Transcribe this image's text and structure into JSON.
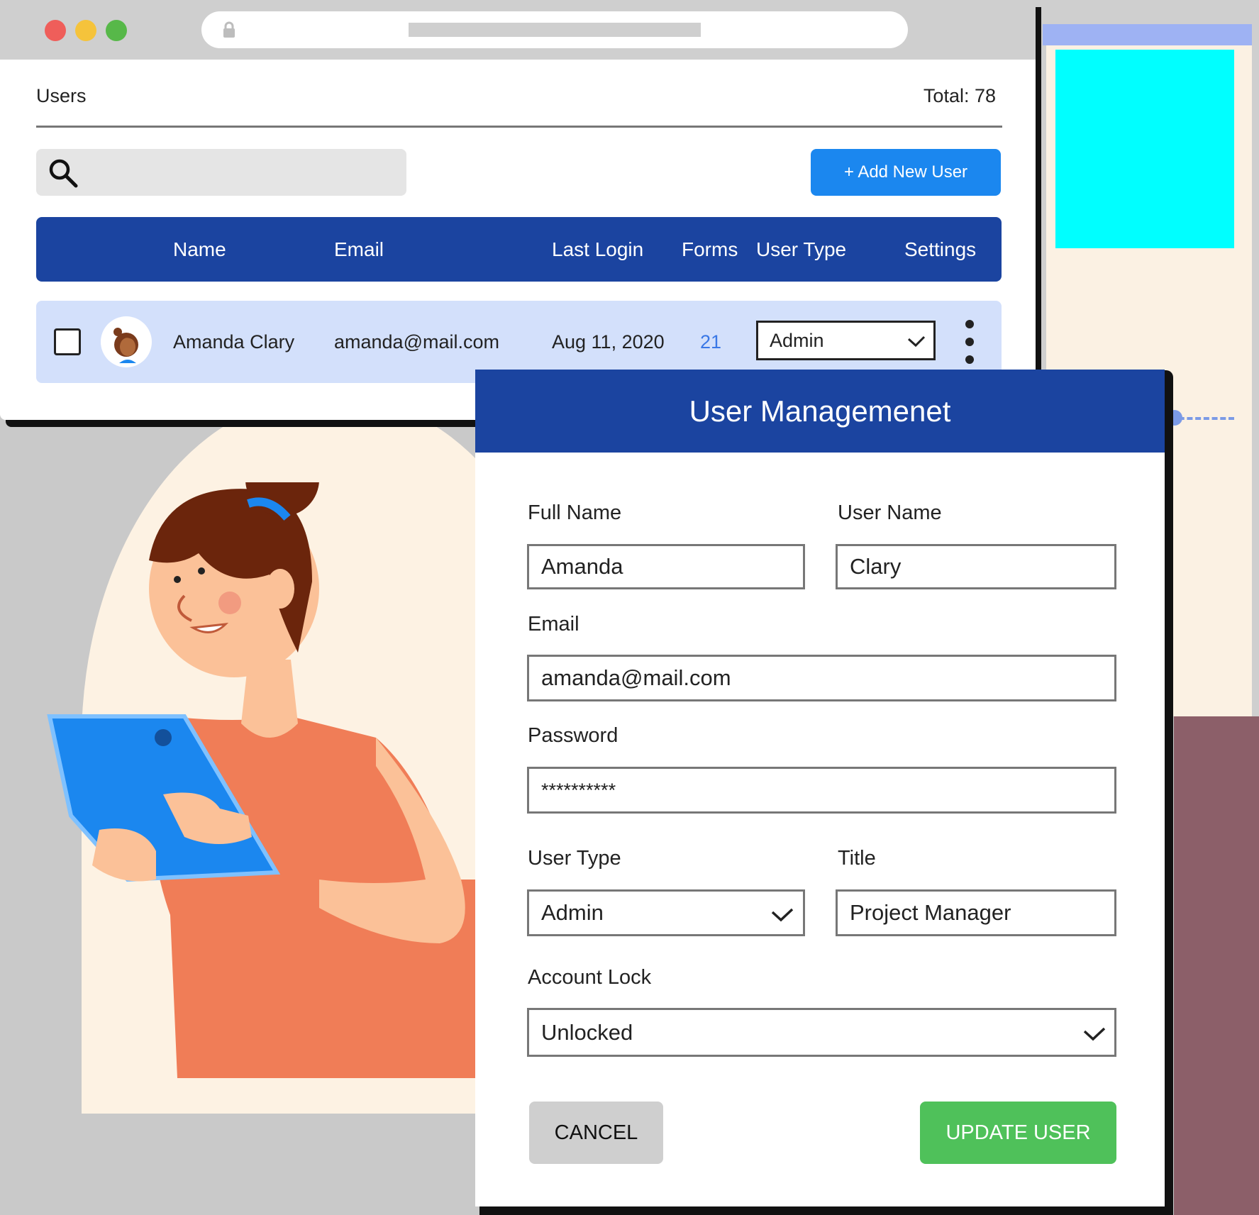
{
  "users_page": {
    "title": "Users",
    "total": "Total: 78",
    "search": {
      "placeholder": ""
    },
    "add_user_label": "+ Add New User",
    "columns": [
      "Name",
      "Email",
      "Last Login",
      "Forms",
      "User Type",
      "Settings"
    ],
    "rows": [
      {
        "name": "Amanda Clary",
        "email": "amanda@mail.com",
        "last_login": "Aug 11, 2020",
        "forms": "21",
        "user_type": "Admin"
      }
    ]
  },
  "modal": {
    "title": "User Managemenet",
    "full_name": {
      "label": "Full Name",
      "value": "Amanda"
    },
    "user_name": {
      "label": "User Name",
      "value": "Clary"
    },
    "email": {
      "label": "Email",
      "value": "amanda@mail.com"
    },
    "password": {
      "label": "Password",
      "value": "**********"
    },
    "user_type": {
      "label": "User Type",
      "value": "Admin"
    },
    "title_field": {
      "label": "Title",
      "value": "Project Manager"
    },
    "account_lock": {
      "label": "Account Lock",
      "value": "Unlocked"
    },
    "cancel_label": "CANCEL",
    "update_label": "UPDATE USER"
  },
  "icons": {
    "window_controls": [
      "close-dot-icon",
      "minimize-dot-icon",
      "maximize-dot-icon"
    ],
    "lock": "lock-icon",
    "search": "search-icon",
    "chevron": "chevron-down-icon",
    "more": "kebab-menu-icon"
  },
  "colors": {
    "primary_blue": "#1b44a0",
    "accent_blue": "#1b87ef",
    "row_highlight": "#d3e0fb",
    "success_green": "#4fc15a"
  }
}
